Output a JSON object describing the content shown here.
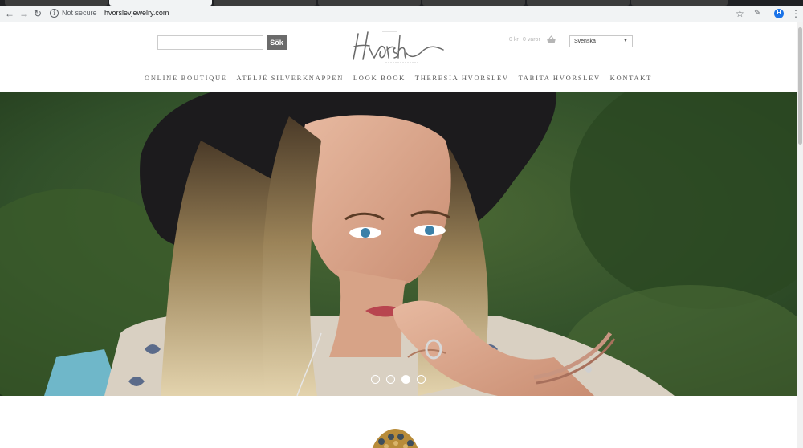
{
  "browser": {
    "url": "hvorslevjewelry.com",
    "security_label": "Not secure",
    "profile_initial": "H"
  },
  "header": {
    "search_button": "Sök",
    "search_value": "",
    "cart_total": "0 kr",
    "cart_count": "0 varor",
    "language": "Svenska",
    "logo_alt": "Hvorslev Swedish Jewelry"
  },
  "nav": {
    "items": [
      {
        "label": "ONLINE BOUTIQUE"
      },
      {
        "label": "ATELJÉ SILVERKNAPPEN"
      },
      {
        "label": "LOOK BOOK"
      },
      {
        "label": "THERESIA HVORSLEV"
      },
      {
        "label": "TABITA HVORSLEV"
      },
      {
        "label": "KONTAKT"
      }
    ]
  },
  "hero": {
    "slides": 4,
    "active_slide": 3
  },
  "colors": {
    "search_button": "#6b6b6b",
    "nav_text": "#555555",
    "foliage": "#2e4a24"
  }
}
